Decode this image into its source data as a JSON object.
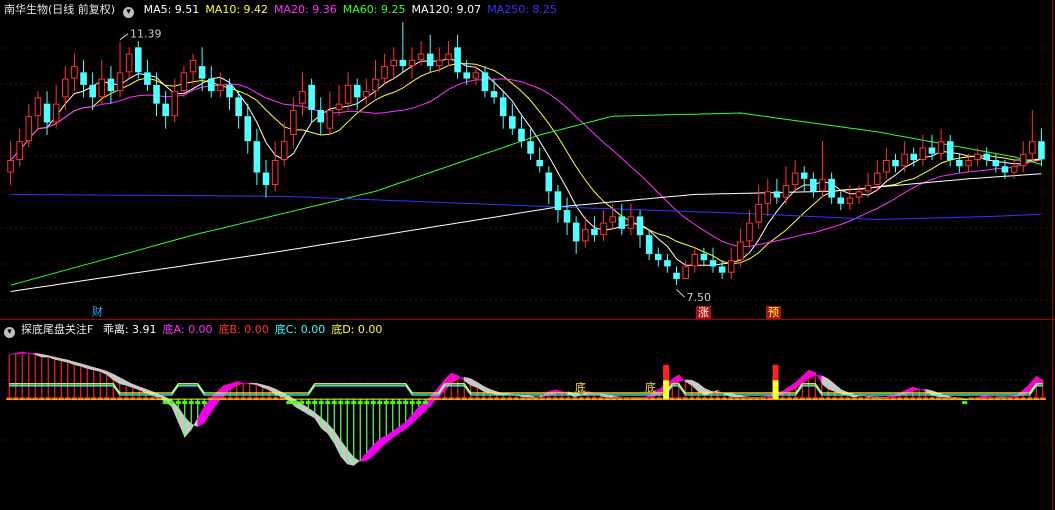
{
  "main_header": {
    "title": "南华生物(日线 前复权)",
    "ma": [
      {
        "label": "MA5:",
        "value": "9.51",
        "color": "#ffffff"
      },
      {
        "label": "MA10:",
        "value": "9.42",
        "color": "#ffff33"
      },
      {
        "label": "MA20:",
        "value": "9.36",
        "color": "#ff33ff"
      },
      {
        "label": "MA60:",
        "value": "9.25",
        "color": "#33ff33"
      },
      {
        "label": "MA120:",
        "value": "9.07",
        "color": "#ffffff"
      },
      {
        "label": "MA250:",
        "value": "8.25",
        "color": "#3333ff"
      }
    ]
  },
  "ind_header": {
    "name": "探底尾盘关注F",
    "items": [
      {
        "label": "乖离:",
        "value": "3.91",
        "color": "#ffffff"
      },
      {
        "label": "底A:",
        "value": "0.00",
        "color": "#ff33ff"
      },
      {
        "label": "底B:",
        "value": "0.00",
        "color": "#ff3333"
      },
      {
        "label": "底C:",
        "value": "0.00",
        "color": "#33ffff"
      },
      {
        "label": "底D:",
        "value": "0.00",
        "color": "#ffff33"
      }
    ]
  },
  "markers": {
    "cai": "财",
    "zhang": "涨",
    "yu": "预",
    "di_1": "底",
    "di_2": "底"
  },
  "chart_data": [
    {
      "type": "candlestick",
      "y_range": [
        7.2,
        11.8
      ],
      "colors": {
        "up": "#ff3333",
        "down": "#54ffff"
      },
      "annotations": [
        {
          "text": "11.39",
          "value": 11.39,
          "candle": 12
        },
        {
          "text": "7.50",
          "value": 7.5,
          "candle": 73
        }
      ],
      "candles": [
        [
          9.3,
          9.5,
          9.8,
          9.1
        ],
        [
          9.5,
          9.8,
          10.0,
          9.4
        ],
        [
          9.8,
          10.2,
          10.4,
          9.7
        ],
        [
          10.2,
          10.5,
          10.6,
          10.0
        ],
        [
          10.4,
          10.1,
          10.6,
          9.9
        ],
        [
          10.1,
          10.4,
          10.7,
          10.0
        ],
        [
          10.5,
          10.8,
          11.0,
          10.3
        ],
        [
          10.8,
          11.0,
          11.2,
          10.6
        ],
        [
          10.9,
          10.7,
          11.1,
          10.5
        ],
        [
          10.7,
          10.5,
          10.9,
          10.3
        ],
        [
          10.5,
          10.8,
          11.1,
          10.4
        ],
        [
          10.8,
          10.6,
          11.0,
          10.4
        ],
        [
          10.6,
          10.9,
          11.39,
          10.5
        ],
        [
          10.9,
          11.2,
          11.3,
          10.8
        ],
        [
          11.3,
          10.9,
          11.4,
          10.8
        ],
        [
          10.9,
          10.7,
          11.1,
          10.6
        ],
        [
          10.7,
          10.4,
          10.9,
          10.2
        ],
        [
          10.4,
          10.2,
          10.6,
          10.0
        ],
        [
          10.2,
          10.6,
          10.8,
          10.1
        ],
        [
          10.6,
          10.9,
          11.0,
          10.5
        ],
        [
          10.9,
          11.1,
          11.2,
          10.7
        ],
        [
          11.0,
          10.8,
          11.3,
          10.6
        ],
        [
          10.8,
          10.6,
          11.0,
          10.5
        ],
        [
          10.6,
          10.7,
          10.9,
          10.5
        ],
        [
          10.7,
          10.5,
          10.8,
          10.3
        ],
        [
          10.5,
          10.2,
          10.6,
          10.0
        ],
        [
          10.2,
          9.8,
          10.4,
          9.6
        ],
        [
          9.8,
          9.3,
          10.0,
          9.1
        ],
        [
          9.3,
          9.1,
          9.5,
          8.9
        ],
        [
          9.1,
          9.5,
          9.8,
          9.0
        ],
        [
          9.5,
          9.8,
          10.1,
          9.4
        ],
        [
          9.9,
          10.3,
          10.5,
          9.7
        ],
        [
          10.4,
          10.6,
          10.9,
          10.2
        ],
        [
          10.7,
          10.3,
          10.8,
          10.1
        ],
        [
          10.3,
          10.1,
          10.5,
          9.9
        ],
        [
          10.0,
          10.3,
          10.6,
          9.9
        ],
        [
          10.3,
          10.4,
          10.7,
          10.2
        ],
        [
          10.4,
          10.7,
          10.9,
          10.3
        ],
        [
          10.7,
          10.5,
          10.8,
          10.3
        ],
        [
          10.5,
          10.6,
          10.8,
          10.4
        ],
        [
          10.6,
          10.8,
          11.1,
          10.5
        ],
        [
          10.8,
          11.0,
          11.2,
          10.7
        ],
        [
          11.0,
          11.1,
          11.3,
          10.8
        ],
        [
          11.1,
          11.0,
          11.7,
          10.9
        ],
        [
          11.0,
          11.1,
          11.3,
          10.8
        ],
        [
          11.1,
          11.2,
          11.4,
          11.0
        ],
        [
          11.2,
          11.0,
          11.5,
          10.9
        ],
        [
          11.0,
          11.1,
          11.3,
          10.9
        ],
        [
          11.1,
          11.2,
          11.4,
          11.0
        ],
        [
          11.3,
          10.9,
          11.5,
          10.8
        ],
        [
          10.9,
          10.8,
          11.1,
          10.7
        ],
        [
          10.8,
          10.9,
          11.0,
          10.7
        ],
        [
          10.9,
          10.6,
          11.0,
          10.5
        ],
        [
          10.6,
          10.5,
          10.8,
          10.4
        ],
        [
          10.5,
          10.2,
          10.6,
          10.0
        ],
        [
          10.2,
          10.0,
          10.4,
          9.9
        ],
        [
          10.0,
          9.8,
          10.2,
          9.7
        ],
        [
          9.8,
          9.6,
          10.0,
          9.5
        ],
        [
          9.5,
          9.4,
          9.7,
          9.3
        ],
        [
          9.3,
          9.0,
          9.4,
          8.8
        ],
        [
          9.0,
          8.7,
          9.1,
          8.5
        ],
        [
          8.7,
          8.5,
          8.9,
          8.3
        ],
        [
          8.5,
          8.2,
          8.6,
          8.0
        ],
        [
          8.2,
          8.4,
          8.6,
          8.1
        ],
        [
          8.4,
          8.3,
          8.6,
          8.2
        ],
        [
          8.3,
          8.5,
          8.7,
          8.2
        ],
        [
          8.5,
          8.6,
          8.8,
          8.4
        ],
        [
          8.6,
          8.4,
          8.8,
          8.3
        ],
        [
          8.4,
          8.6,
          8.8,
          8.3
        ],
        [
          8.6,
          8.3,
          8.7,
          8.1
        ],
        [
          8.3,
          8.0,
          8.4,
          7.9
        ],
        [
          8.0,
          7.9,
          8.1,
          7.8
        ],
        [
          7.9,
          7.8,
          8.0,
          7.7
        ],
        [
          7.7,
          7.6,
          7.8,
          7.5
        ],
        [
          7.6,
          7.8,
          7.9,
          7.6
        ],
        [
          7.8,
          8.0,
          8.1,
          7.7
        ],
        [
          8.0,
          7.9,
          8.1,
          7.8
        ],
        [
          7.9,
          7.8,
          8.1,
          7.7
        ],
        [
          7.8,
          7.7,
          7.9,
          7.6
        ],
        [
          7.7,
          7.9,
          8.1,
          7.6
        ],
        [
          7.9,
          8.2,
          8.4,
          7.8
        ],
        [
          8.2,
          8.5,
          8.7,
          8.1
        ],
        [
          8.5,
          8.8,
          9.1,
          8.4
        ],
        [
          8.8,
          9.0,
          9.2,
          8.6
        ],
        [
          9.0,
          8.9,
          9.2,
          8.8
        ],
        [
          8.9,
          9.1,
          9.4,
          8.8
        ],
        [
          9.1,
          9.3,
          9.5,
          9.0
        ],
        [
          9.3,
          9.2,
          9.4,
          9.0
        ],
        [
          9.2,
          9.0,
          9.3,
          8.9
        ],
        [
          9.0,
          9.2,
          9.8,
          8.9
        ],
        [
          9.2,
          8.9,
          9.3,
          8.8
        ],
        [
          8.9,
          8.8,
          9.0,
          8.7
        ],
        [
          8.8,
          8.9,
          9.1,
          8.7
        ],
        [
          8.9,
          9.0,
          9.1,
          8.8
        ],
        [
          9.0,
          9.1,
          9.3,
          8.9
        ],
        [
          9.1,
          9.3,
          9.5,
          9.0
        ],
        [
          9.3,
          9.5,
          9.7,
          9.2
        ],
        [
          9.5,
          9.4,
          9.6,
          9.3
        ],
        [
          9.4,
          9.6,
          9.8,
          9.3
        ],
        [
          9.6,
          9.5,
          9.7,
          9.4
        ],
        [
          9.5,
          9.7,
          9.9,
          9.4
        ],
        [
          9.7,
          9.6,
          9.9,
          9.5
        ],
        [
          9.6,
          9.8,
          10.0,
          9.5
        ],
        [
          9.8,
          9.5,
          9.9,
          9.4
        ],
        [
          9.5,
          9.4,
          9.6,
          9.3
        ],
        [
          9.4,
          9.5,
          9.6,
          9.3
        ],
        [
          9.5,
          9.6,
          9.7,
          9.4
        ],
        [
          9.6,
          9.5,
          9.7,
          9.4
        ],
        [
          9.5,
          9.4,
          9.6,
          9.3
        ],
        [
          9.4,
          9.3,
          9.5,
          9.2
        ],
        [
          9.3,
          9.4,
          9.5,
          9.2
        ],
        [
          9.4,
          9.6,
          9.8,
          9.3
        ],
        [
          9.6,
          9.8,
          10.3,
          9.5
        ],
        [
          9.8,
          9.51,
          10.0,
          9.4
        ]
      ],
      "ma_series": [
        {
          "name": "MA5",
          "period": 5,
          "color": "#ffffff"
        },
        {
          "name": "MA10",
          "period": 10,
          "color": "#ffff33"
        },
        {
          "name": "MA20",
          "period": 20,
          "color": "#ff33ff"
        },
        {
          "name": "MA60",
          "period": 60,
          "color": "#33ff33",
          "anchors": [
            [
              0,
              7.5
            ],
            [
              20,
              8.3
            ],
            [
              40,
              9.0
            ],
            [
              58,
              9.9
            ],
            [
              66,
              10.2
            ],
            [
              80,
              10.25
            ],
            [
              95,
              9.95
            ],
            [
              110,
              9.55
            ],
            [
              115,
              9.35
            ]
          ]
        },
        {
          "name": "MA120",
          "period": 120,
          "color": "#ffffff",
          "anchors": [
            [
              0,
              7.4
            ],
            [
              30,
              8.05
            ],
            [
              60,
              8.75
            ],
            [
              75,
              8.95
            ],
            [
              90,
              9.0
            ],
            [
              105,
              9.2
            ],
            [
              115,
              9.3
            ]
          ]
        },
        {
          "name": "MA250",
          "period": 250,
          "color": "#3333ff",
          "anchors": [
            [
              0,
              8.95
            ],
            [
              30,
              8.92
            ],
            [
              60,
              8.75
            ],
            [
              80,
              8.65
            ],
            [
              95,
              8.55
            ],
            [
              108,
              8.6
            ],
            [
              115,
              8.65
            ]
          ]
        }
      ]
    },
    {
      "type": "indicator",
      "name": "探底尾盘关注F",
      "y_range": [
        -14,
        8
      ],
      "deviation": [
        5.8,
        6.0,
        6.2,
        6.0,
        5.8,
        5.5,
        5.5,
        5.2,
        5.0,
        4.8,
        4.5,
        4.3,
        4.0,
        3.8,
        3.6,
        3.2,
        2.5,
        2.0,
        1.8,
        1.5,
        1.2,
        0.8,
        0.5,
        0.1,
        -0.3,
        -1.0,
        -3.0,
        -5.0,
        -4.0,
        -2.5,
        -1.0,
        0.2,
        1.0,
        1.8,
        2.0,
        2.3,
        2.1,
        2.0,
        1.9,
        1.5,
        1.2,
        0.6,
        0.2,
        -0.2,
        -1.0,
        -1.5,
        -2.0,
        -2.5,
        -3.8,
        -4.5,
        -5.8,
        -7.5,
        -8.5,
        -8.7,
        -8.0,
        -7.0,
        -6.0,
        -5.2,
        -4.8,
        -4.2,
        -3.6,
        -3.0,
        -2.0,
        -1.0,
        -0.3,
        0.5,
        1.5,
        2.6,
        3.4,
        3.1,
        2.4,
        1.8,
        1.5,
        1.0,
        0.8,
        0.6,
        0.6,
        0.7,
        0.5,
        0.3,
        0.2,
        0.1,
        0.5,
        1.0,
        1.2,
        1.0,
        0.6,
        0.3,
        0.5,
        1.0,
        0.8,
        0.4,
        0.2,
        0.1,
        0.3,
        0.2,
        0.1,
        0.0,
        0.3,
        0.8,
        1.3,
        2.0,
        2.6,
        3.2,
        2.3,
        1.8,
        1.0,
        0.5,
        0.8,
        1.2,
        0.6,
        0.3,
        0.2,
        0.3,
        0.2,
        0.2,
        0.3,
        0.5,
        0.8,
        1.1,
        1.6,
        2.2,
        3.0,
        3.8,
        3.5,
        2.0,
        1.3,
        1.0,
        0.7,
        0.5,
        0.2,
        0.5,
        0.3,
        0.2,
        0.1,
        0.3,
        0.5,
        0.8,
        1.2,
        1.6,
        1.3,
        1.0,
        0.5,
        0.3,
        0.2,
        0.1,
        0.0,
        -0.1,
        0.0,
        0.2,
        0.5,
        0.3,
        0.2,
        0.2,
        0.3,
        0.5,
        1.2,
        2.0,
        3.0,
        2.5
      ],
      "support_level": 0.5,
      "di_signals": [
        [
          72,
          4.5
        ],
        [
          84,
          4.5
        ]
      ]
    }
  ]
}
